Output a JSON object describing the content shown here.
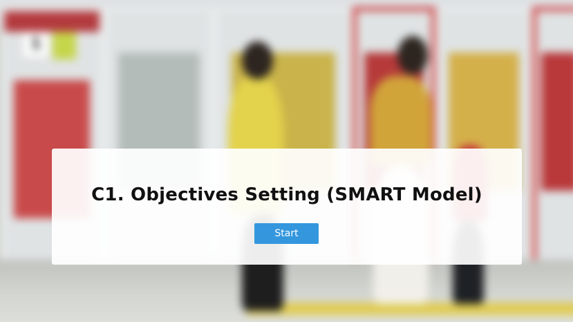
{
  "slide": {
    "title": "C1. Objectives Setting (SMART Model)",
    "start_label": "Start"
  },
  "background": {
    "scene": "station-platform-photo",
    "door_number": "1"
  },
  "colors": {
    "button_bg": "#3497de",
    "button_text": "#ffffff",
    "card_bg": "#ffffff",
    "title_text": "#111111"
  }
}
